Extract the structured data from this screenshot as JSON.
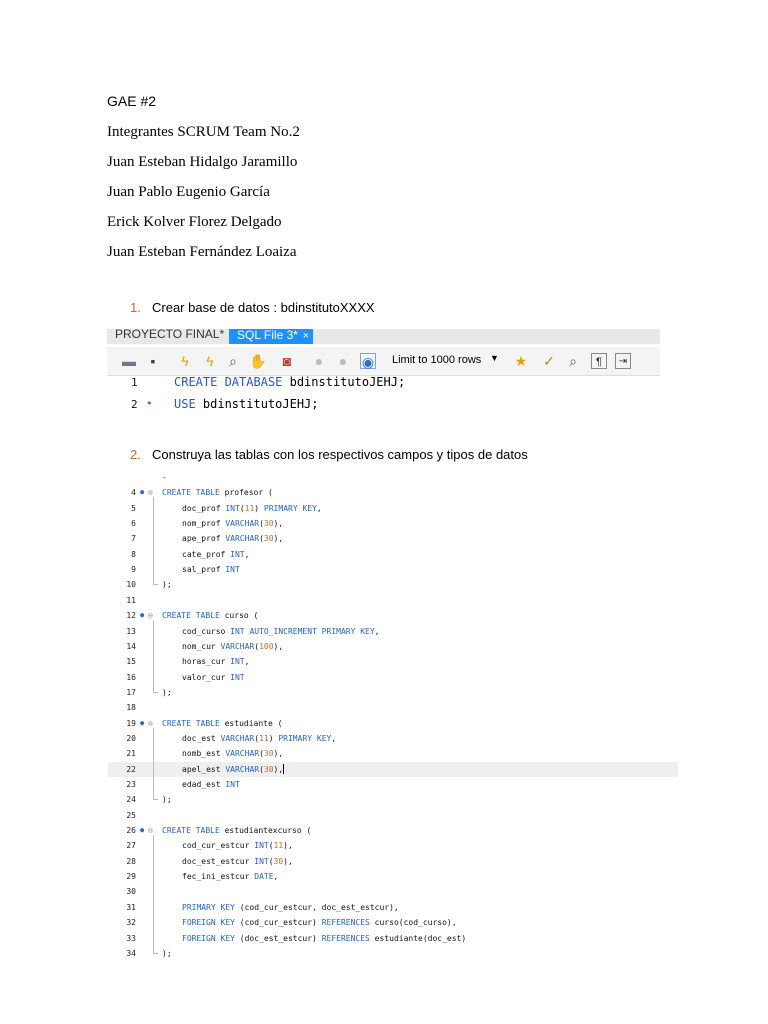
{
  "heading": "GAE #2",
  "team_title": "Integrantes SCRUM Team No.2",
  "members": [
    "Juan Esteban Hidalgo Jaramillo",
    "Juan Pablo Eugenio García",
    "Erick Kolver Florez Delgado",
    "Juan Esteban Fernández Loaiza"
  ],
  "steps": [
    {
      "num": "1.",
      "text": "Crear base de datos : bdinstitutoXXXX"
    },
    {
      "num": "2.",
      "text": "Construya las tablas con los respectivos campos y tipos de datos"
    }
  ],
  "workbench": {
    "tabs": [
      {
        "label": "PROYECTO FINAL*",
        "active": false
      },
      {
        "label": "SQL File 3*",
        "active": true,
        "close": "×"
      }
    ],
    "toolbar_icons": [
      "folder-icon",
      "save-icon",
      "execute-icon",
      "execute-current-icon",
      "explain-icon",
      "stop-icon",
      "toggle-error-icon",
      "commit-icon",
      "rollback-icon",
      "autocommit-icon"
    ],
    "limit_label": "Limit to 1000 rows",
    "right_icons": [
      "bookmark-star-icon",
      "beautify-icon",
      "find-icon",
      "invisible-chars-icon",
      "wrap-icon"
    ],
    "lines": [
      {
        "num": "1",
        "marker": "",
        "kw": "CREATE DATABASE",
        "rest": " bdinstitutoJEHJ;"
      },
      {
        "num": "2",
        "marker": "•",
        "kw": "USE",
        "rest": " bdinstitutoJEHJ;"
      }
    ]
  },
  "code_lines": [
    {
      "ln": "",
      "mk": "",
      "fold": "",
      "text": "-",
      "indent": 0
    },
    {
      "ln": "4",
      "mk": "●",
      "fold": "⊖",
      "parts": [
        [
          "kw",
          "CREATE TABLE"
        ],
        [
          "t",
          " profesor ("
        ]
      ],
      "indent": 0
    },
    {
      "ln": "5",
      "parts": [
        [
          "t",
          "doc_prof "
        ],
        [
          "kw",
          "INT"
        ],
        [
          "t",
          "("
        ],
        [
          "n",
          "11"
        ],
        [
          "t",
          ") "
        ],
        [
          "kw",
          "PRIMARY KEY"
        ],
        [
          "t",
          ","
        ]
      ],
      "indent": 1
    },
    {
      "ln": "6",
      "parts": [
        [
          "t",
          "nom_prof "
        ],
        [
          "kw",
          "VARCHAR"
        ],
        [
          "t",
          "("
        ],
        [
          "n",
          "30"
        ],
        [
          "t",
          "),"
        ]
      ],
      "indent": 1
    },
    {
      "ln": "7",
      "parts": [
        [
          "t",
          "ape_prof "
        ],
        [
          "kw",
          "VARCHAR"
        ],
        [
          "t",
          "("
        ],
        [
          "n",
          "30"
        ],
        [
          "t",
          "),"
        ]
      ],
      "indent": 1
    },
    {
      "ln": "8",
      "parts": [
        [
          "t",
          "cate_prof "
        ],
        [
          "kw",
          "INT"
        ],
        [
          "t",
          ","
        ]
      ],
      "indent": 1
    },
    {
      "ln": "9",
      "parts": [
        [
          "t",
          "sal_prof "
        ],
        [
          "kw",
          "INT"
        ]
      ],
      "indent": 1
    },
    {
      "ln": "10",
      "parts": [
        [
          "t",
          ");"
        ]
      ],
      "indent": 0
    },
    {
      "ln": "11",
      "parts": [],
      "indent": 0
    },
    {
      "ln": "12",
      "mk": "●",
      "fold": "⊖",
      "parts": [
        [
          "kw",
          "CREATE TABLE"
        ],
        [
          "t",
          " curso ("
        ]
      ],
      "indent": 0
    },
    {
      "ln": "13",
      "parts": [
        [
          "t",
          "cod_curso "
        ],
        [
          "kw",
          "INT AUTO_INCREMENT PRIMARY KEY"
        ],
        [
          "t",
          ","
        ]
      ],
      "indent": 1
    },
    {
      "ln": "14",
      "parts": [
        [
          "t",
          "nom_cur "
        ],
        [
          "kw",
          "VARCHAR"
        ],
        [
          "t",
          "("
        ],
        [
          "n",
          "100"
        ],
        [
          "t",
          "),"
        ]
      ],
      "indent": 1
    },
    {
      "ln": "15",
      "parts": [
        [
          "t",
          "horas_cur "
        ],
        [
          "kw",
          "INT"
        ],
        [
          "t",
          ","
        ]
      ],
      "indent": 1
    },
    {
      "ln": "16",
      "parts": [
        [
          "t",
          "valor_cur "
        ],
        [
          "kw",
          "INT"
        ]
      ],
      "indent": 1
    },
    {
      "ln": "17",
      "parts": [
        [
          "t",
          ");"
        ]
      ],
      "indent": 0
    },
    {
      "ln": "18",
      "parts": [],
      "indent": 0
    },
    {
      "ln": "19",
      "mk": "●",
      "fold": "⊖",
      "parts": [
        [
          "kw",
          "CREATE TABLE"
        ],
        [
          "t",
          " estudiante ("
        ]
      ],
      "indent": 0
    },
    {
      "ln": "20",
      "parts": [
        [
          "t",
          "doc_est "
        ],
        [
          "kw",
          "VARCHAR"
        ],
        [
          "t",
          "("
        ],
        [
          "n",
          "11"
        ],
        [
          "t",
          ") "
        ],
        [
          "kw",
          "PRIMARY KEY"
        ],
        [
          "t",
          ","
        ]
      ],
      "indent": 1
    },
    {
      "ln": "21",
      "parts": [
        [
          "t",
          "nomb_est "
        ],
        [
          "kw",
          "VARCHAR"
        ],
        [
          "t",
          "("
        ],
        [
          "n",
          "30"
        ],
        [
          "t",
          "),"
        ]
      ],
      "indent": 1
    },
    {
      "ln": "22",
      "parts": [
        [
          "t",
          "apel_est "
        ],
        [
          "kw",
          "VARCHAR"
        ],
        [
          "t",
          "("
        ],
        [
          "n",
          "30"
        ],
        [
          "t",
          "),"
        ],
        [
          "c",
          ""
        ]
      ],
      "indent": 1,
      "highlight": true
    },
    {
      "ln": "23",
      "parts": [
        [
          "t",
          "edad_est "
        ],
        [
          "kw",
          "INT"
        ]
      ],
      "indent": 1
    },
    {
      "ln": "24",
      "parts": [
        [
          "t",
          ");"
        ]
      ],
      "indent": 0
    },
    {
      "ln": "25",
      "parts": [],
      "indent": 0
    },
    {
      "ln": "26",
      "mk": "●",
      "fold": "⊖",
      "parts": [
        [
          "kw",
          "CREATE TABLE"
        ],
        [
          "t",
          " estudiantexcurso ("
        ]
      ],
      "indent": 0
    },
    {
      "ln": "27",
      "parts": [
        [
          "t",
          "cod_cur_estcur "
        ],
        [
          "kw",
          "INT"
        ],
        [
          "t",
          "("
        ],
        [
          "n",
          "11"
        ],
        [
          "t",
          "),"
        ]
      ],
      "indent": 1
    },
    {
      "ln": "28",
      "parts": [
        [
          "t",
          "doc_est_estcur "
        ],
        [
          "kw",
          "INT"
        ],
        [
          "t",
          "("
        ],
        [
          "n",
          "30"
        ],
        [
          "t",
          "),"
        ]
      ],
      "indent": 1
    },
    {
      "ln": "29",
      "parts": [
        [
          "t",
          "fec_ini_estcur "
        ],
        [
          "kw",
          "DATE"
        ],
        [
          "t",
          ","
        ]
      ],
      "indent": 1
    },
    {
      "ln": "30",
      "parts": [],
      "indent": 0
    },
    {
      "ln": "31",
      "parts": [
        [
          "kw",
          "PRIMARY KEY"
        ],
        [
          "t",
          " (cod_cur_estcur, doc_est_estcur),"
        ]
      ],
      "indent": 1
    },
    {
      "ln": "32",
      "parts": [
        [
          "kw",
          "FOREIGN KEY"
        ],
        [
          "t",
          " (cod_cur_estcur) "
        ],
        [
          "kw",
          "REFERENCES"
        ],
        [
          "t",
          " curso(cod_curso),"
        ]
      ],
      "indent": 1
    },
    {
      "ln": "33",
      "parts": [
        [
          "kw",
          "FOREIGN KEY"
        ],
        [
          "t",
          " (doc_est_estcur) "
        ],
        [
          "kw",
          "REFERENCES"
        ],
        [
          "t",
          " estudiante(doc_est)"
        ]
      ],
      "indent": 1
    },
    {
      "ln": "34",
      "parts": [
        [
          "t",
          ");"
        ]
      ],
      "indent": 0
    }
  ]
}
